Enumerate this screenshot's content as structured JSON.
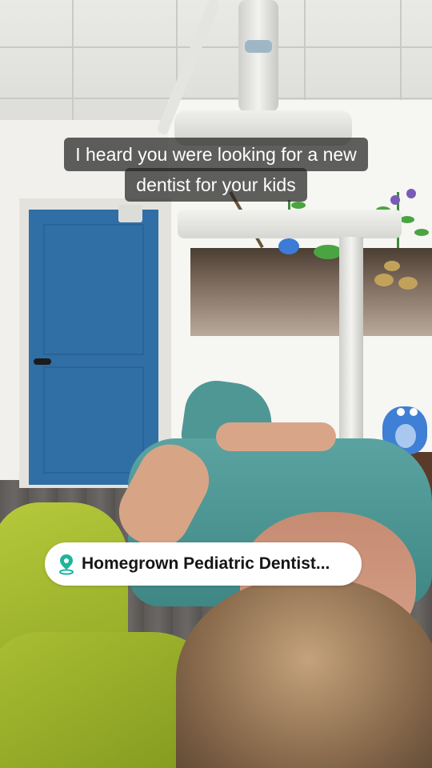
{
  "caption": {
    "line1": "I heard you were looking for a new",
    "line2": "dentist for your kids"
  },
  "location_sticker": {
    "label": "Homegrown Pediatric Dentist...",
    "icon": "map-pin-icon",
    "pin_color": "#1fb59a"
  }
}
